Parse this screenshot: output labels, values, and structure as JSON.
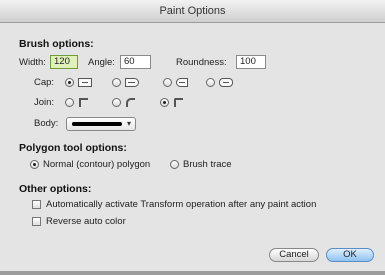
{
  "window": {
    "title": "Paint Options"
  },
  "brush": {
    "heading": "Brush options:",
    "width_label": "Width:",
    "width_value": "120",
    "angle_label": "Angle:",
    "angle_value": "60",
    "roundness_label": "Roundness:",
    "roundness_value": "100",
    "cap_label": "Cap:",
    "cap_options": [
      "butt-cap-icon",
      "round-cap-icon",
      "projecting-cap-icon",
      "square-cap-icon"
    ],
    "cap_selected": 0,
    "join_label": "Join:",
    "join_options": [
      "miter-join-icon",
      "round-join-icon",
      "bevel-join-icon"
    ],
    "join_selected": 2,
    "body_label": "Body:",
    "body_color": "#000000"
  },
  "polygon": {
    "heading": "Polygon tool options:",
    "option_normal": "Normal (contour) polygon",
    "option_trace": "Brush trace",
    "selected": "normal"
  },
  "other": {
    "heading": "Other options:",
    "auto_transform_label": "Automatically activate Transform operation after any paint action",
    "auto_transform_checked": false,
    "reverse_color_label": "Reverse auto color",
    "reverse_color_checked": false
  },
  "buttons": {
    "cancel": "Cancel",
    "ok": "OK"
  },
  "colors": {
    "active_field": "#dff1b9",
    "default_button": "#8fc2ef"
  }
}
